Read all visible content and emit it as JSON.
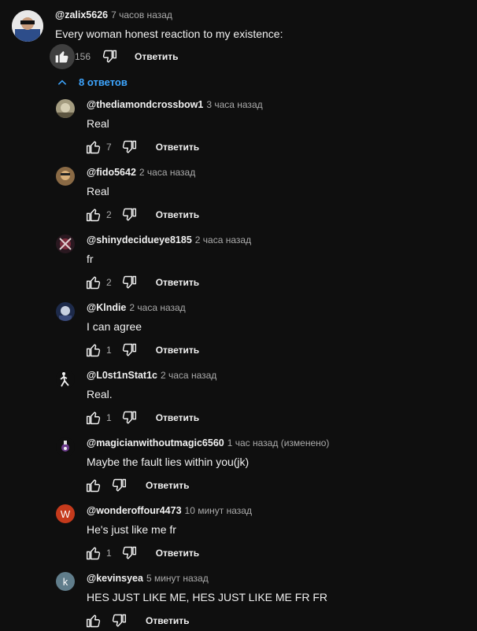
{
  "top": {
    "author": "@zalix5626",
    "time": "7 часов назад",
    "text": "Every woman honest reaction to my existence:",
    "likes": "156",
    "reply_label": "Ответить"
  },
  "replies_toggle": {
    "label": "8 ответов"
  },
  "replies": [
    {
      "author": "@thediamondcrossbow1",
      "time": "3 часа назад",
      "text": "Real",
      "likes": "7",
      "reply_label": "Ответить"
    },
    {
      "author": "@fido5642",
      "time": "2 часа назад",
      "text": "Real",
      "likes": "2",
      "reply_label": "Ответить"
    },
    {
      "author": "@shinydecidueye8185",
      "time": "2 часа назад",
      "text": "fr",
      "likes": "2",
      "reply_label": "Ответить"
    },
    {
      "author": "@Klndie",
      "time": "2 часа назад",
      "text": "I can agree",
      "likes": "1",
      "reply_label": "Ответить"
    },
    {
      "author": "@L0st1nStat1c",
      "time": "2 часа назад",
      "text": "Real.",
      "likes": "1",
      "reply_label": "Ответить"
    },
    {
      "author": "@magicianwithoutmagic6560",
      "time": "1 час назад (изменено)",
      "text": "Maybe the fault lies within you(jk)",
      "likes": "",
      "reply_label": "Ответить"
    },
    {
      "author": "@wonderoffour4473",
      "time": "10 минут назад",
      "text": "He's just like me fr",
      "likes": "1",
      "reply_label": "Ответить",
      "avatar_letter": "W"
    },
    {
      "author": "@kevinsyea",
      "time": "5 минут назад",
      "text": "HES JUST LIKE ME, HES JUST LIKE ME FR FR",
      "likes": "",
      "reply_label": "Ответить",
      "avatar_letter": "k"
    }
  ],
  "colors": {
    "background": "#0f0f0f",
    "link_blue": "#3ea6ff",
    "avatar_w": "#c53a1c",
    "avatar_k": "#607d8b"
  }
}
